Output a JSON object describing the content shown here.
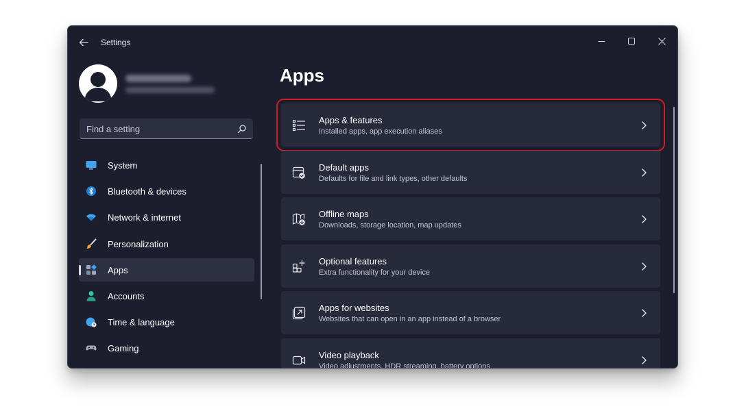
{
  "window": {
    "title": "Settings"
  },
  "sidebar": {
    "search": {
      "placeholder": "Find a setting"
    },
    "items": [
      {
        "label": "System",
        "icon": "monitor-icon",
        "selected": false
      },
      {
        "label": "Bluetooth & devices",
        "icon": "bluetooth-icon",
        "selected": false
      },
      {
        "label": "Network & internet",
        "icon": "wifi-icon",
        "selected": false
      },
      {
        "label": "Personalization",
        "icon": "brush-icon",
        "selected": false
      },
      {
        "label": "Apps",
        "icon": "apps-icon",
        "selected": true
      },
      {
        "label": "Accounts",
        "icon": "person-icon",
        "selected": false
      },
      {
        "label": "Time & language",
        "icon": "globe-clock-icon",
        "selected": false
      },
      {
        "label": "Gaming",
        "icon": "gamepad-icon",
        "selected": false
      }
    ]
  },
  "main": {
    "title": "Apps",
    "cards": [
      {
        "title": "Apps & features",
        "subtitle": "Installed apps, app execution aliases",
        "icon": "list-icon",
        "highlighted": true
      },
      {
        "title": "Default apps",
        "subtitle": "Defaults for file and link types, other defaults",
        "icon": "default-apps-icon",
        "highlighted": false
      },
      {
        "title": "Offline maps",
        "subtitle": "Downloads, storage location, map updates",
        "icon": "map-download-icon",
        "highlighted": false
      },
      {
        "title": "Optional features",
        "subtitle": "Extra functionality for your device",
        "icon": "add-feature-icon",
        "highlighted": false
      },
      {
        "title": "Apps for websites",
        "subtitle": "Websites that can open in an app instead of a browser",
        "icon": "open-in-app-icon",
        "highlighted": false
      },
      {
        "title": "Video playback",
        "subtitle": "Video adjustments, HDR streaming, battery options",
        "icon": "video-icon",
        "highlighted": false
      }
    ]
  },
  "colors": {
    "window_bg": "#1c1e2d",
    "card_bg": "#262a3b",
    "selected_bg": "#2d3043",
    "highlight_outline": "#d11c24",
    "accent_blue": "#3ea4ef"
  }
}
